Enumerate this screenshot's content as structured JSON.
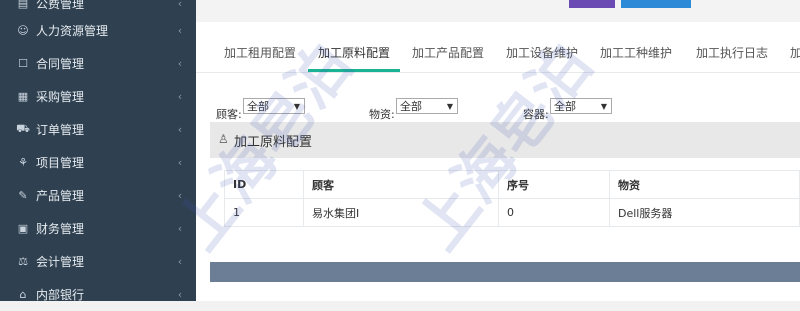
{
  "sidebar": {
    "items": [
      {
        "label": "公费管理",
        "icon": "receipt-icon"
      },
      {
        "label": "人力资源管理",
        "icon": "users-icon"
      },
      {
        "label": "合同管理",
        "icon": "document-icon"
      },
      {
        "label": "采购管理",
        "icon": "list-icon"
      },
      {
        "label": "订单管理",
        "icon": "cart-icon"
      },
      {
        "label": "项目管理",
        "icon": "sitemap-icon"
      },
      {
        "label": "产品管理",
        "icon": "edit-icon"
      },
      {
        "label": "财务管理",
        "icon": "money-icon"
      },
      {
        "label": "会计管理",
        "icon": "scale-icon"
      },
      {
        "label": "内部银行",
        "icon": "bank-icon"
      }
    ]
  },
  "tabs": [
    {
      "label": "加工租用配置"
    },
    {
      "label": "加工原料配置",
      "active": true
    },
    {
      "label": "加工产品配置"
    },
    {
      "label": "加工设备维护"
    },
    {
      "label": "加工工种维护"
    },
    {
      "label": "加工执行日志"
    },
    {
      "label": "加"
    }
  ],
  "filters": {
    "customer": {
      "label": "顾客:",
      "value": "全部"
    },
    "material": {
      "label": "物资:",
      "value": "全部"
    },
    "container": {
      "label": "容器:",
      "value": "全部"
    }
  },
  "panel": {
    "title": "加工原料配置"
  },
  "table": {
    "headers": [
      "ID",
      "顾客",
      "序号",
      "物资"
    ],
    "rows": [
      [
        "1",
        "易水集团I",
        "0",
        "Dell服务器"
      ]
    ]
  },
  "watermark": "上海皂泊",
  "colors": {
    "sidebar": "#2f4050",
    "accent": "#1ab394",
    "bottom_bar": "#6c7e95"
  }
}
